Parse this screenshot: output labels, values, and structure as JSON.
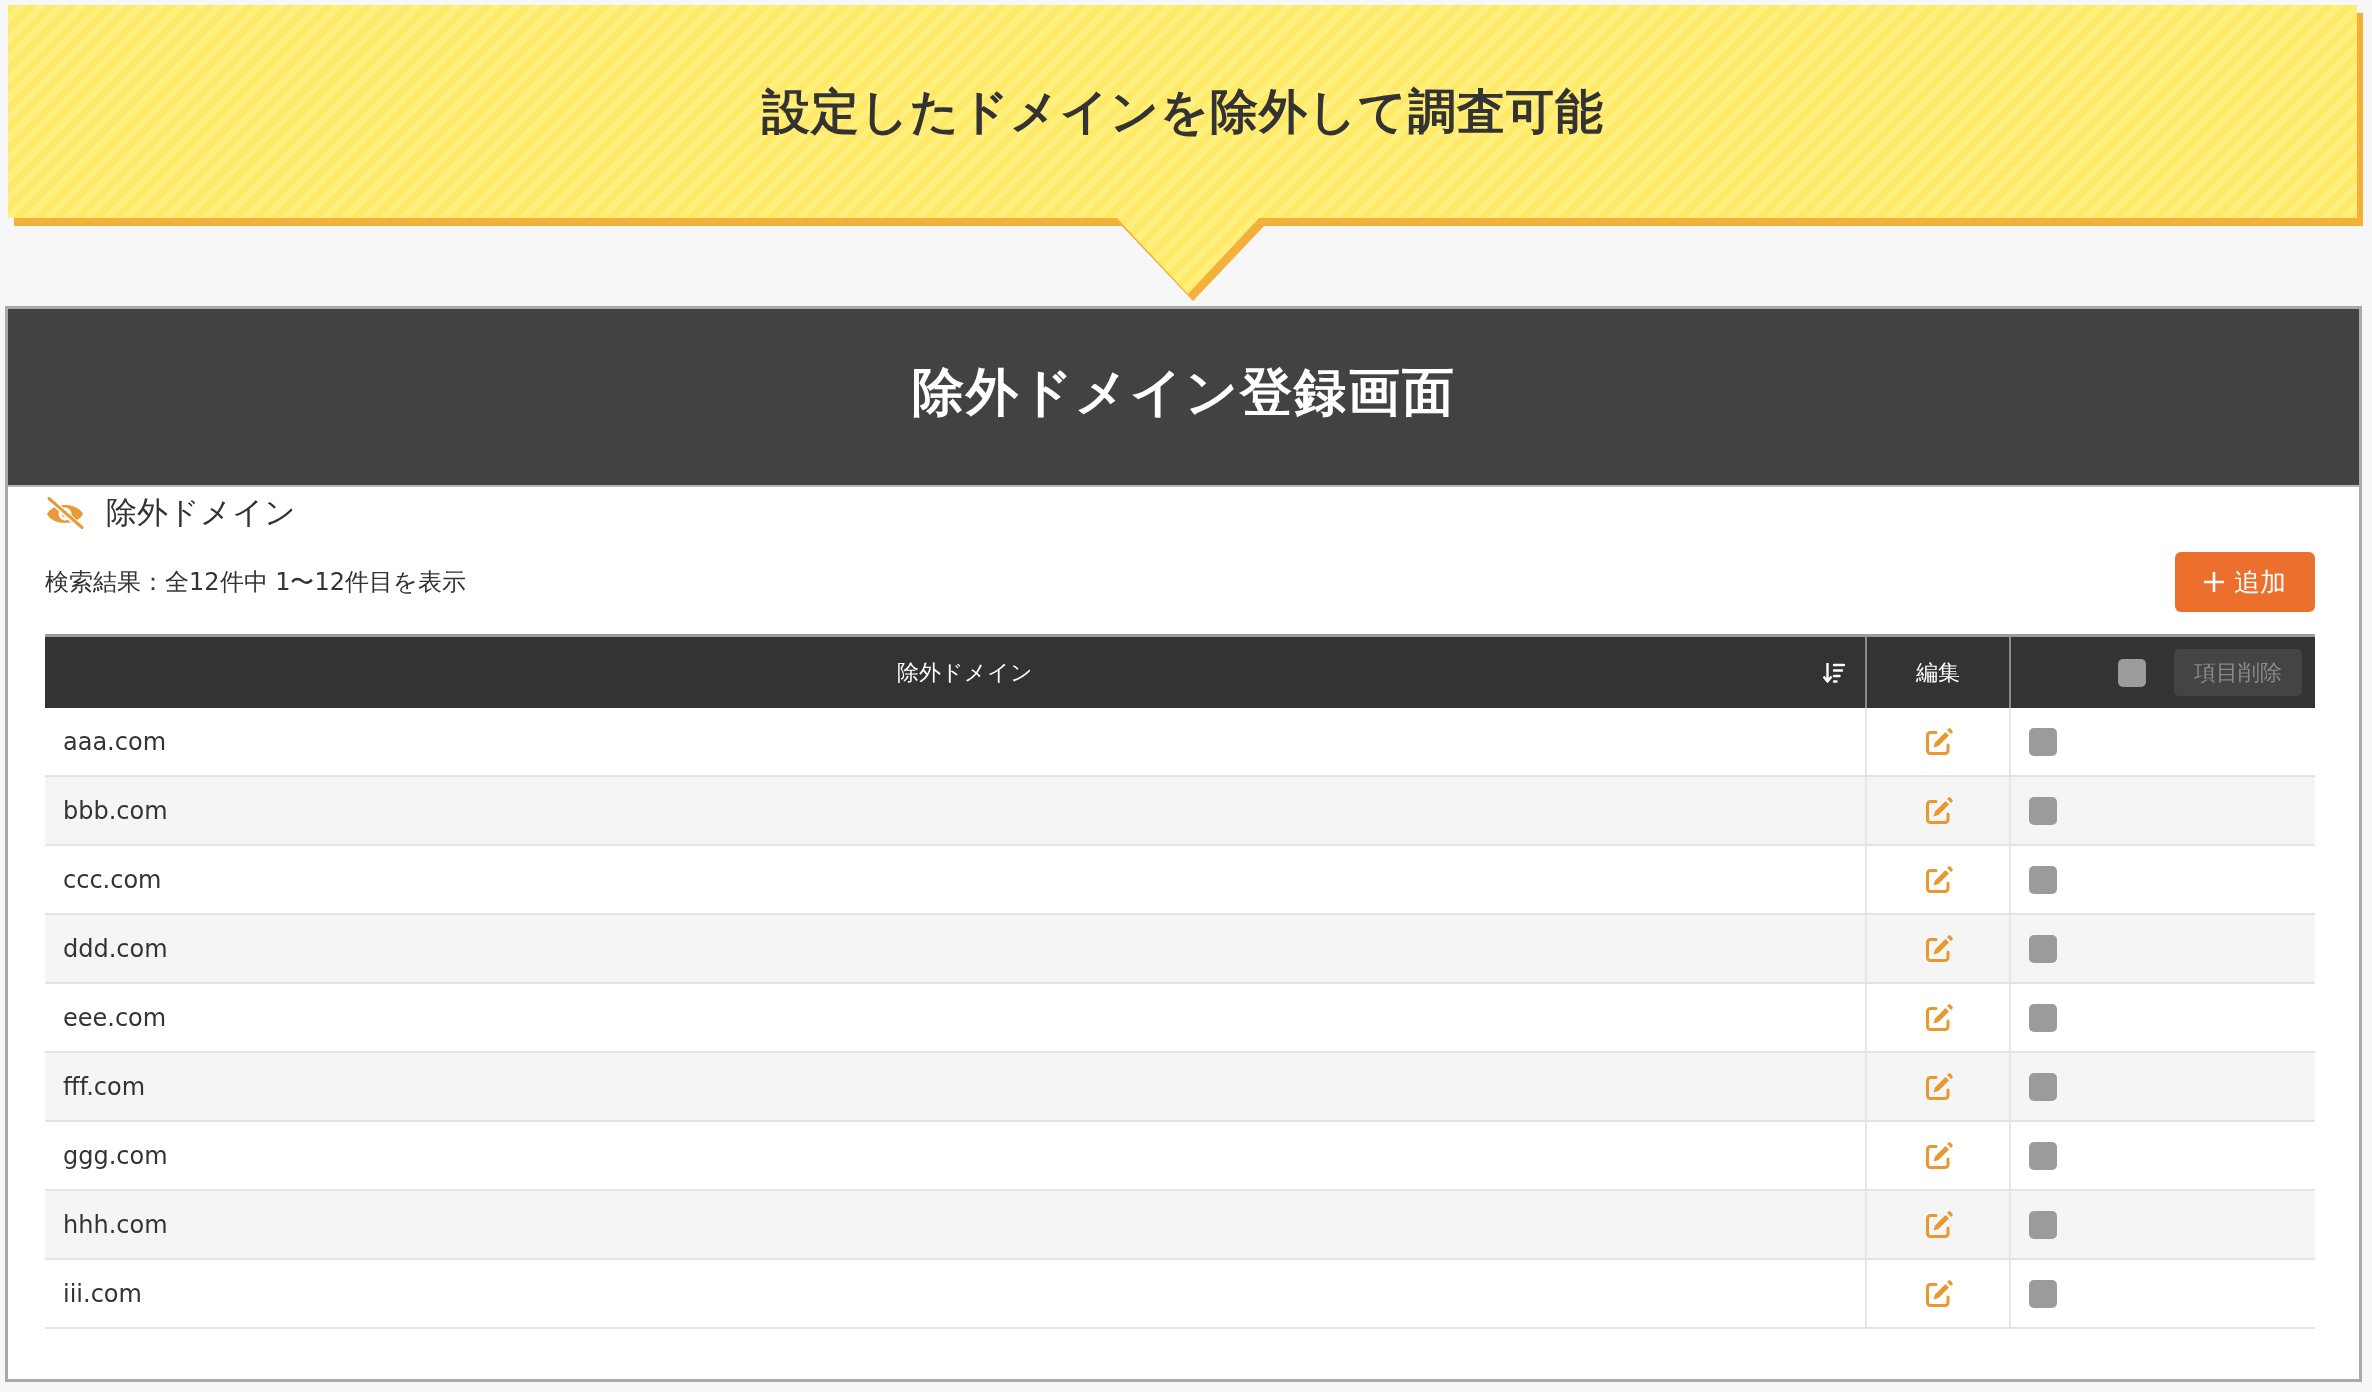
{
  "callout": {
    "text": "設定したドメインを除外して調査可能"
  },
  "panel": {
    "title": "除外ドメイン登録画面",
    "section_title": "除外ドメイン",
    "result_summary": "検索結果：全12件中 1〜12件目を表示",
    "add_button": {
      "label": "追加"
    },
    "table": {
      "columns": [
        {
          "kind": "sortable",
          "label": "除外ドメイン"
        },
        {
          "kind": "edit",
          "label": "編集"
        },
        {
          "kind": "select",
          "checked": false,
          "action": {
            "label": "項目削除",
            "disabled": true
          }
        }
      ],
      "rows": [
        {
          "domain": "aaa.com",
          "checked": false
        },
        {
          "domain": "bbb.com",
          "checked": false
        },
        {
          "domain": "ccc.com",
          "checked": false
        },
        {
          "domain": "ddd.com",
          "checked": false
        },
        {
          "domain": "eee.com",
          "checked": false
        },
        {
          "domain": "fff.com",
          "checked": false
        },
        {
          "domain": "ggg.com",
          "checked": false
        },
        {
          "domain": "hhh.com",
          "checked": false
        },
        {
          "domain": "iii.com",
          "checked": false
        }
      ]
    }
  }
}
